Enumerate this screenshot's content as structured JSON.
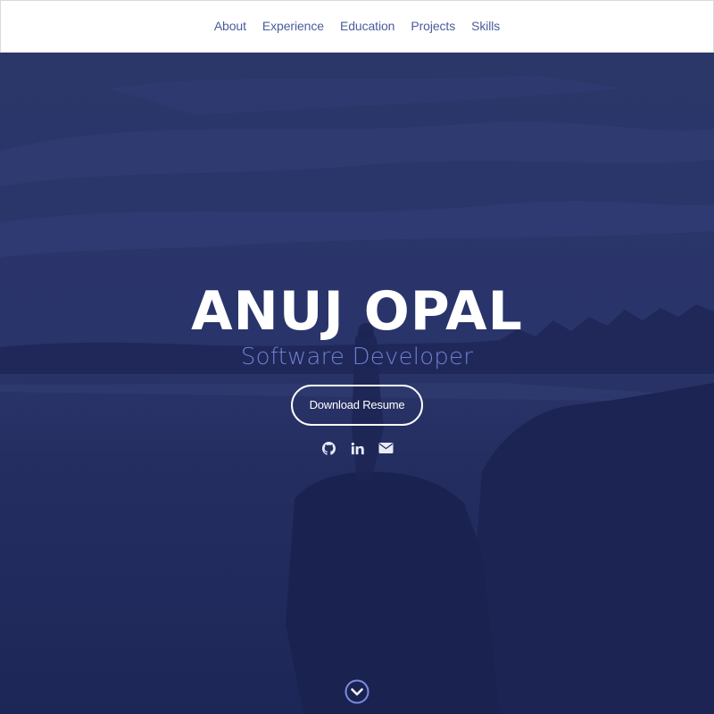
{
  "nav": {
    "items": [
      {
        "label": "About"
      },
      {
        "label": "Experience"
      },
      {
        "label": "Education"
      },
      {
        "label": "Projects"
      },
      {
        "label": "Skills"
      }
    ]
  },
  "hero": {
    "name": "ANUJ OPAL",
    "role": "Software Developer",
    "resume_button": "Download Resume",
    "social_icons": [
      "github-icon",
      "linkedin-icon",
      "email-icon"
    ],
    "scroll_icon": "chevron-down-circle-icon"
  },
  "colors": {
    "overlay": "#1f2a5c",
    "nav_text": "#4b5c9c",
    "accent": "#6f7fd1",
    "white": "#ffffff"
  }
}
